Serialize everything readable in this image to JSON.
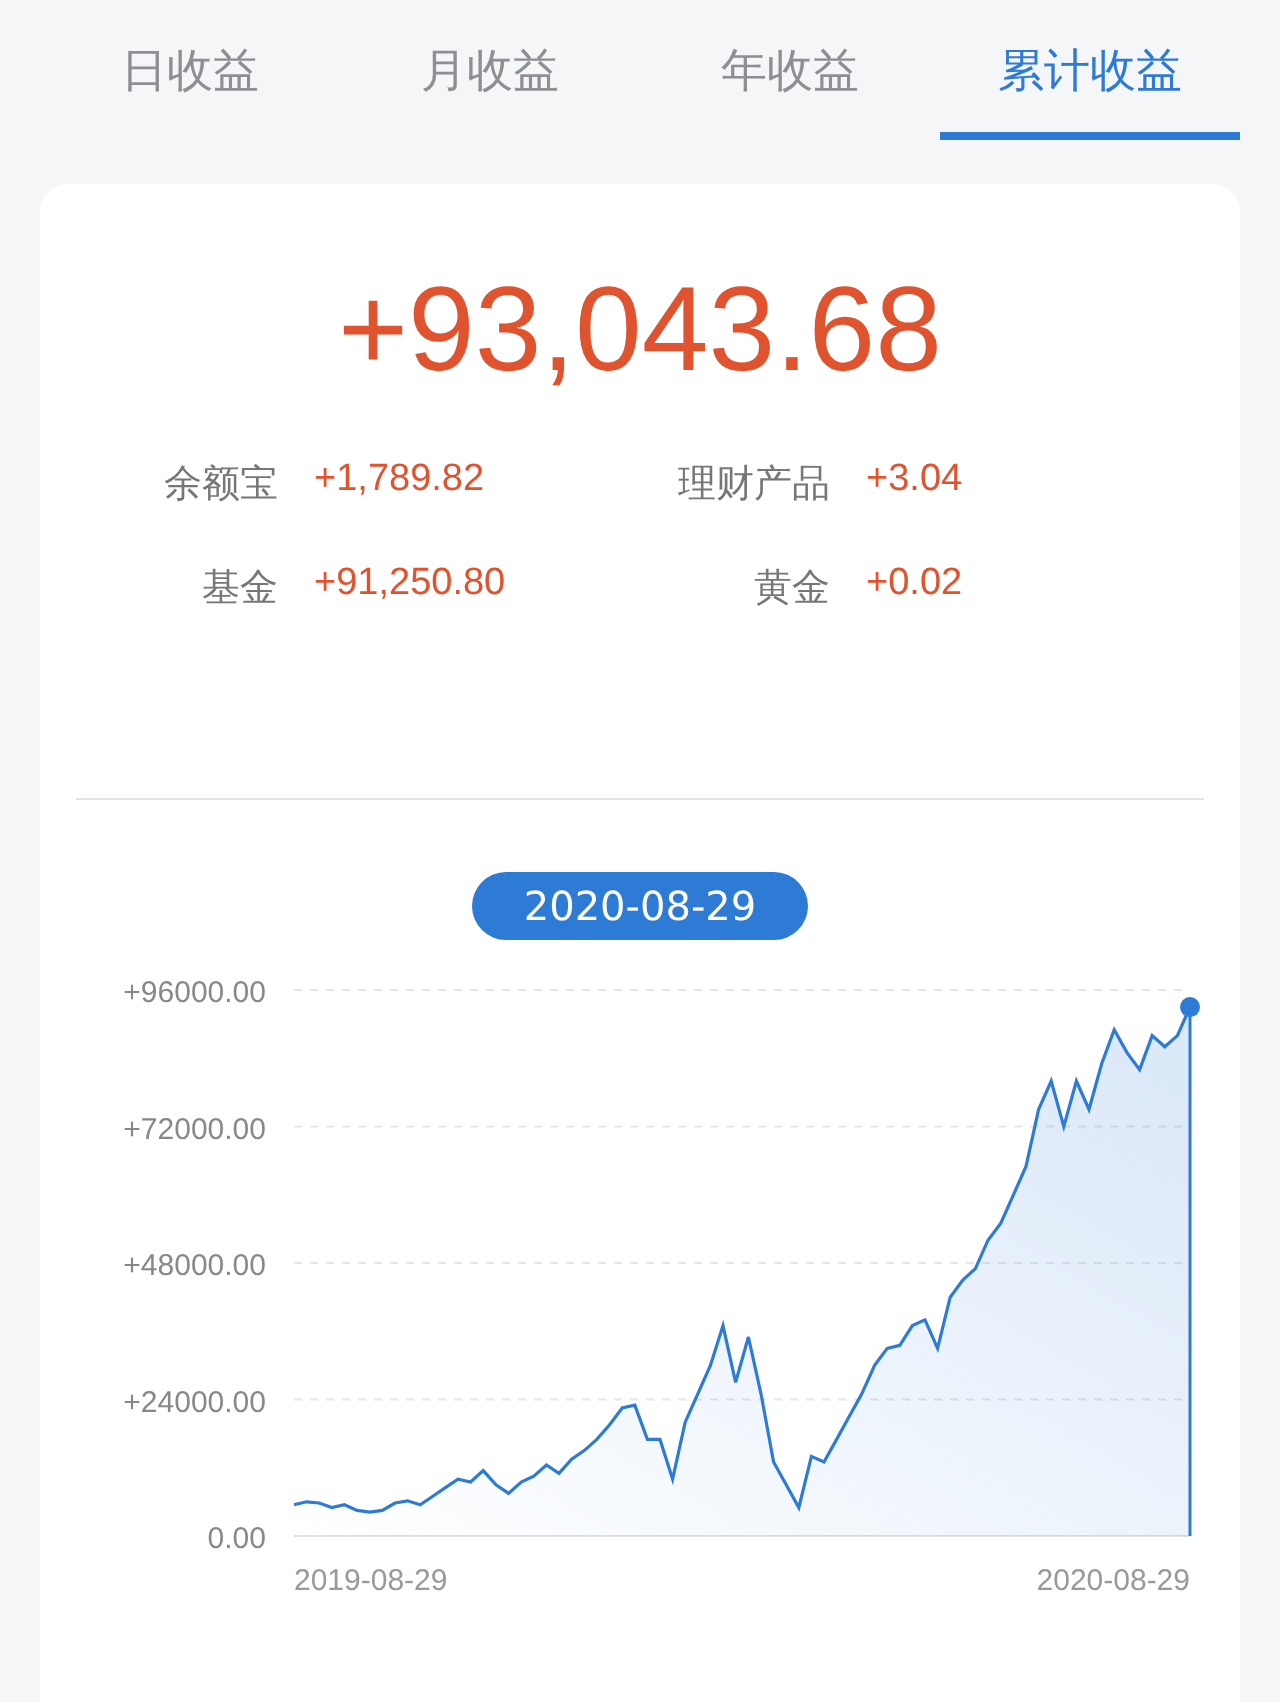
{
  "tabs": [
    {
      "label": "日收益",
      "selected": false
    },
    {
      "label": "月收益",
      "selected": false
    },
    {
      "label": "年收益",
      "selected": false
    },
    {
      "label": "累计收益",
      "selected": true
    }
  ],
  "total": "+93,043.68",
  "breakdown": [
    {
      "label": "余额宝",
      "value": "+1,789.82"
    },
    {
      "label": "理财产品",
      "value": "+3.04"
    },
    {
      "label": "基金",
      "value": "+91,250.80"
    },
    {
      "label": "黄金",
      "value": "+0.02"
    }
  ],
  "selected_date": "2020-08-29",
  "chart_data": {
    "type": "area",
    "grid": true,
    "ylim": [
      0,
      96000
    ],
    "yticks": [
      {
        "value": 0,
        "label": "0.00"
      },
      {
        "value": 24000,
        "label": "+24000.00"
      },
      {
        "value": 48000,
        "label": "+48000.00"
      },
      {
        "value": 72000,
        "label": "+72000.00"
      },
      {
        "value": 96000,
        "label": "+96000.00"
      }
    ],
    "series": [
      {
        "color": "#2e7bd6",
        "values": [
          5500,
          6000,
          5800,
          5000,
          5500,
          4500,
          4200,
          4500,
          5800,
          6200,
          5500,
          7000,
          8500,
          10000,
          9500,
          11500,
          9000,
          7500,
          9500,
          10500,
          12500,
          11000,
          13500,
          15000,
          17000,
          19500,
          22500,
          23000,
          17000,
          17000,
          10000,
          20000,
          25000,
          30000,
          37000,
          27000,
          35000,
          25000,
          13000,
          9000,
          5000,
          14000,
          13000,
          17000,
          21000,
          25000,
          30000,
          33000,
          33500,
          37000,
          38000,
          33000,
          42000,
          45000,
          47000,
          52000,
          55000,
          60000,
          65000,
          75000,
          80000,
          72000,
          80000,
          75000,
          83000,
          89000,
          85000,
          82000,
          88000,
          86000,
          88000,
          93000
        ]
      }
    ]
  },
  "x_axis_labels": [
    "2019-08-29",
    "2020-08-29"
  ]
}
